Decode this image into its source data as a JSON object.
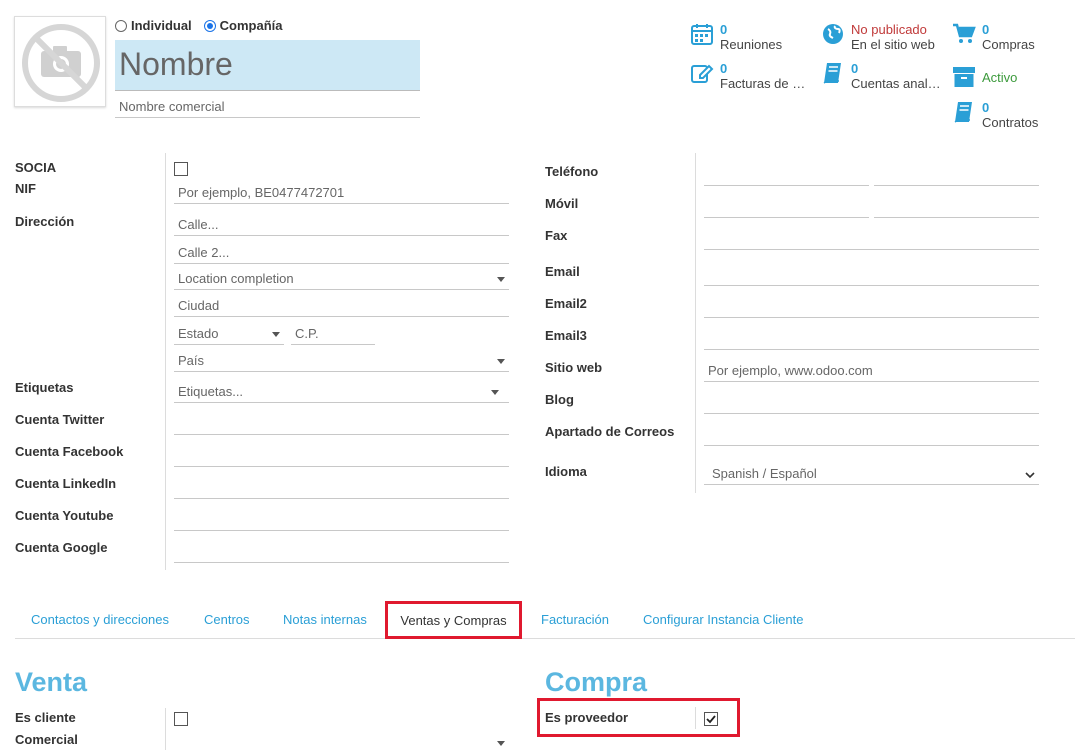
{
  "header": {
    "type_options": [
      {
        "label": "Individual",
        "selected": false
      },
      {
        "label": "Compañía",
        "selected": true
      }
    ],
    "name_placeholder": "Nombre",
    "trade_name_placeholder": "Nombre comercial"
  },
  "smart_buttons": [
    {
      "icon": "calendar-icon",
      "value": "0",
      "label": "Reuniones"
    },
    {
      "icon": "globe-icon",
      "value": "No publicado",
      "label": "En el sitio web",
      "value_color": "#c03939"
    },
    {
      "icon": "cart-icon",
      "value": "0",
      "label": "Compras"
    },
    {
      "icon": "edit-icon",
      "value": "0",
      "label": "Facturas de p..."
    },
    {
      "icon": "book-icon",
      "value": "0",
      "label": "Cuentas analí..."
    },
    {
      "icon": "archive-icon",
      "value": "",
      "label": "Activo",
      "label_color": "#3c9a3c"
    },
    {
      "icon": "book-icon",
      "value": "0",
      "label": "Contratos"
    }
  ],
  "left_labels": {
    "socia": "SOCIA",
    "nif": "NIF",
    "direccion": "Dirección",
    "etiquetas": "Etiquetas",
    "twitter": "Cuenta Twitter",
    "facebook": "Cuenta Facebook",
    "linkedin": "Cuenta LinkedIn",
    "youtube": "Cuenta Youtube",
    "google": "Cuenta Google"
  },
  "left_fields": {
    "nif_placeholder": "Por ejemplo, BE0477472701",
    "street": "Calle...",
    "street2": "Calle 2...",
    "location": "Location completion",
    "city": "Ciudad",
    "state": "Estado",
    "zip": "C.P.",
    "country": "País",
    "tags": "Etiquetas..."
  },
  "right_labels": {
    "telefono": "Teléfono",
    "movil": "Móvil",
    "fax": "Fax",
    "email": "Email",
    "email2": "Email2",
    "email3": "Email3",
    "sitio_web": "Sitio web",
    "blog": "Blog",
    "apartado": "Apartado de Correos",
    "idioma": "Idioma"
  },
  "right_fields": {
    "website_placeholder": "Por ejemplo, www.odoo.com",
    "language": "Spanish / Español"
  },
  "tabs": [
    {
      "label": "Contactos y direcciones",
      "active": false
    },
    {
      "label": "Centros",
      "active": false
    },
    {
      "label": "Notas internas",
      "active": false
    },
    {
      "label": "Ventas y Compras",
      "active": true
    },
    {
      "label": "Facturación",
      "active": false
    },
    {
      "label": "Configurar Instancia Cliente",
      "active": false
    }
  ],
  "sales": {
    "title": "Venta",
    "es_cliente": "Es cliente",
    "comercial": "Comercial"
  },
  "purchase": {
    "title": "Compra",
    "es_proveedor": "Es proveedor"
  },
  "colors": {
    "accent": "#2a9fd6",
    "highlight_border": "#e0192f",
    "name_bg": "#cde8f5"
  }
}
